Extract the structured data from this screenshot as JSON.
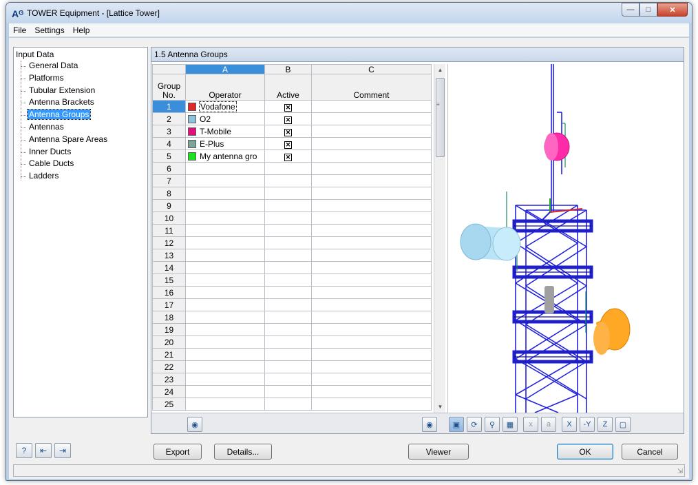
{
  "window": {
    "title": "TOWER Equipment - [Lattice Tower]",
    "app_icon": "Aᴳ"
  },
  "menu": [
    "File",
    "Settings",
    "Help"
  ],
  "tree": {
    "root": "Input Data",
    "items": [
      "General Data",
      "Platforms",
      "Tubular Extension",
      "Antenna Brackets",
      "Antenna Groups",
      "Antennas",
      "Antenna Spare Areas",
      "Inner Ducts",
      "Cable Ducts",
      "Ladders"
    ],
    "selected": "Antenna Groups"
  },
  "panel": {
    "title": "1.5 Antenna Groups"
  },
  "grid": {
    "col_letters": [
      "A",
      "B",
      "C"
    ],
    "headers": {
      "group_no": "Group\nNo.",
      "operator": "Operator",
      "active": "Active",
      "comment": "Comment"
    },
    "rows": [
      {
        "no": "1",
        "operator": "Vodafone",
        "color": "#e02a2a",
        "active": true
      },
      {
        "no": "2",
        "operator": "O2",
        "color": "#8fc0dc",
        "active": true
      },
      {
        "no": "3",
        "operator": "T-Mobile",
        "color": "#e0107a",
        "active": true
      },
      {
        "no": "4",
        "operator": "E-Plus",
        "color": "#7fa598",
        "active": true
      },
      {
        "no": "5",
        "operator": "My antenna gro",
        "color": "#1ee01e",
        "active": true
      }
    ],
    "empty_rows": [
      "6",
      "7",
      "8",
      "9",
      "10",
      "11",
      "12",
      "13",
      "14",
      "15",
      "16",
      "17",
      "18",
      "19",
      "20",
      "21",
      "22",
      "23",
      "24",
      "25"
    ]
  },
  "footer_icons": [
    "color-palette-icon",
    "eye-icon",
    "render-mode-icon",
    "rotate-icon",
    "zoom-icon",
    "display-icon",
    "dim-x-icon",
    "dim-a-icon",
    "view-x-icon",
    "view-y-icon",
    "view-z-icon",
    "iso-view-icon"
  ],
  "footer_icon_labels": {
    "dim_x": "x",
    "dim_a": "a",
    "view_x": "X",
    "view_y": "-Y",
    "view_z": "Z"
  },
  "buttons": {
    "export": "Export",
    "details": "Details...",
    "viewer": "Viewer",
    "ok": "OK",
    "cancel": "Cancel"
  },
  "colors": {
    "selection": "#3399ff",
    "tower": "#2222dd",
    "antenna_magenta": "#ff2aa8",
    "antenna_blue": "#a8d8f0",
    "antenna_orange": "#ff9a10"
  }
}
